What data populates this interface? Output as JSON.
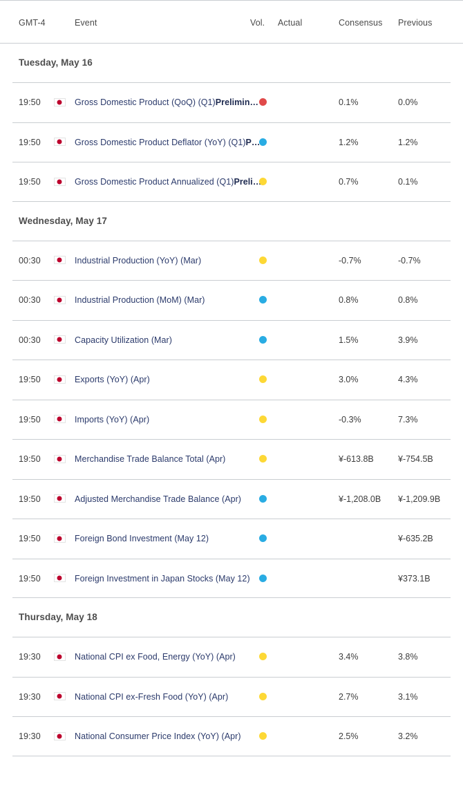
{
  "header": {
    "timezone_label": "GMT-4",
    "event_label": "Event",
    "vol_label": "Vol.",
    "actual_label": "Actual",
    "consensus_label": "Consensus",
    "previous_label": "Previous"
  },
  "colors": {
    "volatility_high": "#e04a4a",
    "volatility_medium": "#29ace3",
    "volatility_low": "#fdd835",
    "event_link": "#2b3a6b",
    "flag_red": "#bc002d",
    "row_divider": "#c9cdd1"
  },
  "days": [
    {
      "heading": "Tuesday, May 16",
      "events": [
        {
          "time": "19:50",
          "country_icon": "flag-japan-icon",
          "name": "Gross Domestic Product (QoQ) (Q1)",
          "name_suffix": "Prelimin…",
          "volatility": "high",
          "actual": "",
          "consensus": "0.1%",
          "previous": "0.0%"
        },
        {
          "time": "19:50",
          "country_icon": "flag-japan-icon",
          "name": "Gross Domestic Product Deflator (YoY) (Q1)",
          "name_suffix": "P…",
          "volatility": "medium",
          "actual": "",
          "consensus": "1.2%",
          "previous": "1.2%"
        },
        {
          "time": "19:50",
          "country_icon": "flag-japan-icon",
          "name": "Gross Domestic Product Annualized (Q1)",
          "name_suffix": "Preli…",
          "volatility": "low",
          "actual": "",
          "consensus": "0.7%",
          "previous": "0.1%"
        }
      ]
    },
    {
      "heading": "Wednesday, May 17",
      "events": [
        {
          "time": "00:30",
          "country_icon": "flag-japan-icon",
          "name": "Industrial Production (YoY) (Mar)",
          "name_suffix": "",
          "volatility": "low",
          "actual": "",
          "consensus": "-0.7%",
          "previous": "-0.7%"
        },
        {
          "time": "00:30",
          "country_icon": "flag-japan-icon",
          "name": "Industrial Production (MoM) (Mar)",
          "name_suffix": "",
          "volatility": "medium",
          "actual": "",
          "consensus": "0.8%",
          "previous": "0.8%"
        },
        {
          "time": "00:30",
          "country_icon": "flag-japan-icon",
          "name": "Capacity Utilization (Mar)",
          "name_suffix": "",
          "volatility": "medium",
          "actual": "",
          "consensus": "1.5%",
          "previous": "3.9%"
        },
        {
          "time": "19:50",
          "country_icon": "flag-japan-icon",
          "name": "Exports (YoY) (Apr)",
          "name_suffix": "",
          "volatility": "low",
          "actual": "",
          "consensus": "3.0%",
          "previous": "4.3%"
        },
        {
          "time": "19:50",
          "country_icon": "flag-japan-icon",
          "name": "Imports (YoY) (Apr)",
          "name_suffix": "",
          "volatility": "low",
          "actual": "",
          "consensus": "-0.3%",
          "previous": "7.3%"
        },
        {
          "time": "19:50",
          "country_icon": "flag-japan-icon",
          "name": "Merchandise Trade Balance Total (Apr)",
          "name_suffix": "",
          "volatility": "low",
          "actual": "",
          "consensus": "¥-613.8B",
          "previous": "¥-754.5B"
        },
        {
          "time": "19:50",
          "country_icon": "flag-japan-icon",
          "name": "Adjusted Merchandise Trade Balance (Apr)",
          "name_suffix": "",
          "volatility": "medium",
          "actual": "",
          "consensus": "¥-1,208.0B",
          "previous": "¥-1,209.9B"
        },
        {
          "time": "19:50",
          "country_icon": "flag-japan-icon",
          "name": "Foreign Bond Investment (May 12)",
          "name_suffix": "",
          "volatility": "medium",
          "actual": "",
          "consensus": "",
          "previous": "¥-635.2B"
        },
        {
          "time": "19:50",
          "country_icon": "flag-japan-icon",
          "name": "Foreign Investment in Japan Stocks (May 12)",
          "name_suffix": "",
          "volatility": "medium",
          "actual": "",
          "consensus": "",
          "previous": "¥373.1B"
        }
      ]
    },
    {
      "heading": "Thursday, May 18",
      "events": [
        {
          "time": "19:30",
          "country_icon": "flag-japan-icon",
          "name": "National CPI ex Food, Energy (YoY) (Apr)",
          "name_suffix": "",
          "volatility": "low",
          "actual": "",
          "consensus": "3.4%",
          "previous": "3.8%"
        },
        {
          "time": "19:30",
          "country_icon": "flag-japan-icon",
          "name": "National CPI ex-Fresh Food (YoY) (Apr)",
          "name_suffix": "",
          "volatility": "low",
          "actual": "",
          "consensus": "2.7%",
          "previous": "3.1%"
        },
        {
          "time": "19:30",
          "country_icon": "flag-japan-icon",
          "name": "National Consumer Price Index (YoY) (Apr)",
          "name_suffix": "",
          "volatility": "low",
          "actual": "",
          "consensus": "2.5%",
          "previous": "3.2%"
        }
      ]
    }
  ]
}
